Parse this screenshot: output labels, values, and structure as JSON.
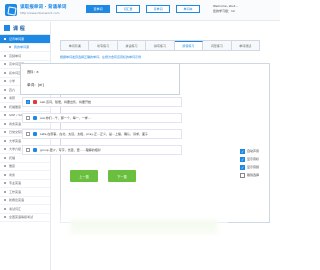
{
  "header": {
    "site_title": "读取报单词 · 背诵单词",
    "site_url": "http://www.ribaoword.com",
    "nav": [
      {
        "label": "查单词"
      },
      {
        "label": "词汇量"
      },
      {
        "label": "背单词"
      },
      {
        "label": "单词本"
      }
    ],
    "welcome_line1": "Welcome, stud…",
    "welcome_line2": "您的学习级：12"
  },
  "sidebar": {
    "title": "课 程",
    "items": [
      {
        "label": "记背单词课",
        "type": "group"
      },
      {
        "label": "我的单词课",
        "type": "sub"
      },
      {
        "label": "高频单词",
        "type": "normal"
      },
      {
        "label": "高中词汇课",
        "type": "normal"
      },
      {
        "label": "初中词汇",
        "type": "normal"
      },
      {
        "label": "小学",
        "type": "normal"
      },
      {
        "label": "四六",
        "type": "normal"
      },
      {
        "label": "考研",
        "type": "normal"
      },
      {
        "label": "托福雅思",
        "type": "normal"
      },
      {
        "label": "GRE / SAT",
        "type": "normal"
      },
      {
        "label": "商务英语",
        "type": "normal"
      },
      {
        "label": "日常交际英语",
        "type": "normal"
      },
      {
        "label": "大学英语",
        "type": "normal"
      },
      {
        "label": "大学六级",
        "type": "normal"
      },
      {
        "label": "托福",
        "type": "normal"
      },
      {
        "label": "雅思",
        "type": "normal"
      },
      {
        "label": "商务",
        "type": "normal"
      },
      {
        "label": "专业英语",
        "type": "normal"
      },
      {
        "label": "工作英语",
        "type": "normal"
      },
      {
        "label": "新概念英语",
        "type": "normal"
      },
      {
        "label": "考试词汇",
        "type": "normal"
      },
      {
        "label": "全国英语等级考试",
        "type": "normal"
      }
    ]
  },
  "tabs": [
    {
      "label": "单词背诵",
      "active": false
    },
    {
      "label": "听写练习",
      "active": false
    },
    {
      "label": "拼读练习",
      "active": false
    },
    {
      "label": "拼写练习",
      "active": false
    },
    {
      "label": "辨音练习",
      "active": true
    },
    {
      "label": "词形练习",
      "active": false
    },
    {
      "label": "单词测试",
      "active": false
    }
  ],
  "hint": "根据单词发音选择正确的单词，左侧为含有该音标的单词示例",
  "question": {
    "phonetic_label": "音标：a",
    "phonetic_value": "单词：[ei]"
  },
  "options": [
    {
      "text": "sell,该词，随便，将要出售，将要开始",
      "checked": true,
      "icon": "red"
    },
    {
      "text": "are,你们…千，那一个，每一，一样…",
      "checked": false,
      "icon": "blue"
    },
    {
      "text": "safe,在意事，在北，太远，太极，pray,正…正义，是…上播，确认，诉求，面子",
      "checked": false,
      "icon": "blue"
    },
    {
      "text": "group,更少，写字，长距，更……理解的相对",
      "checked": false,
      "icon": "blue"
    }
  ],
  "buttons": {
    "prev": "上一题",
    "next": "下一题"
  },
  "settings": [
    {
      "label": "自动声音",
      "checked": true
    },
    {
      "label": "显示音标",
      "checked": true
    },
    {
      "label": "显示音频",
      "checked": true
    },
    {
      "label": "跳到选择",
      "checked": false
    }
  ],
  "colors": {
    "accent": "#1e88e5",
    "button_green": "#6bbf3f",
    "speaker_red": "#e53935"
  }
}
